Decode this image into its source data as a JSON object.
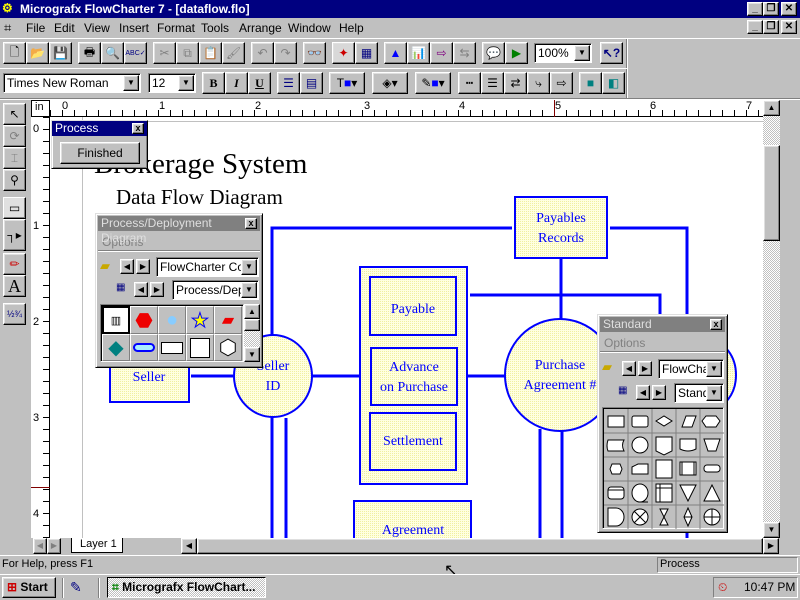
{
  "window": {
    "title": "Micrografx FlowCharter 7 - [dataflow.flo]"
  },
  "menu": [
    {
      "label": "File",
      "key": "F"
    },
    {
      "label": "Edit",
      "key": "E"
    },
    {
      "label": "View",
      "key": "V"
    },
    {
      "label": "Insert",
      "key": "I"
    },
    {
      "label": "Format",
      "key": "o"
    },
    {
      "label": "Tools",
      "key": "T"
    },
    {
      "label": "Arrange",
      "key": "A"
    },
    {
      "label": "Window",
      "key": "W"
    },
    {
      "label": "Help",
      "key": "H"
    }
  ],
  "toolbar": {
    "buttons": [
      "new",
      "open",
      "save",
      "print",
      "print-preview",
      "spell-check",
      "cut",
      "copy",
      "paste",
      "format-painter",
      "undo",
      "redo",
      "find",
      "shape-palette",
      "data-table",
      "chart",
      "graph",
      "link",
      "connect",
      "comment",
      "run",
      "zoom",
      "context-help"
    ],
    "zoom_value": "100%"
  },
  "format_bar": {
    "font_name": "Times New Roman",
    "font_size": "12",
    "bold": "B",
    "italic": "I",
    "underline": "U"
  },
  "ruler": {
    "unit": "in",
    "h_ticks": [
      "0",
      "1",
      "2",
      "3",
      "4",
      "5",
      "6",
      "7"
    ],
    "v_ticks": [
      "0",
      "1",
      "2",
      "3",
      "4"
    ]
  },
  "diagram": {
    "title": "Brokerage System",
    "subtitle": "Data Flow Diagram",
    "nodes": {
      "payables_records": [
        "Payables",
        "Records"
      ],
      "payable": "Payable",
      "advance": [
        "Advance",
        "on Purchase"
      ],
      "settlement": "Settlement",
      "purchase_agreement": [
        "Purchase",
        "Agreement #"
      ],
      "seller": "Seller",
      "seller_id": [
        "Seller",
        "ID"
      ],
      "agreement": "Agreement"
    },
    "colors": {
      "line": "#0000ff",
      "fill": "#ffffc8"
    }
  },
  "process_palette": {
    "title": "Process",
    "button": "Finished"
  },
  "deploy_palette": {
    "title": "Process/Deployment Diagram",
    "options": "Options",
    "library": "FlowCharter Cool",
    "sheet": "Process/Depl"
  },
  "standard_palette": {
    "title": "Standard",
    "options": "Options",
    "library": "FlowChar",
    "sheet": "Stand"
  },
  "layer_tab": "Layer 1",
  "status": {
    "help": "For Help, press F1",
    "mode": "Process"
  },
  "taskbar": {
    "start": "Start",
    "task": "Micrografx FlowChart...",
    "clock": "10:47 PM"
  }
}
